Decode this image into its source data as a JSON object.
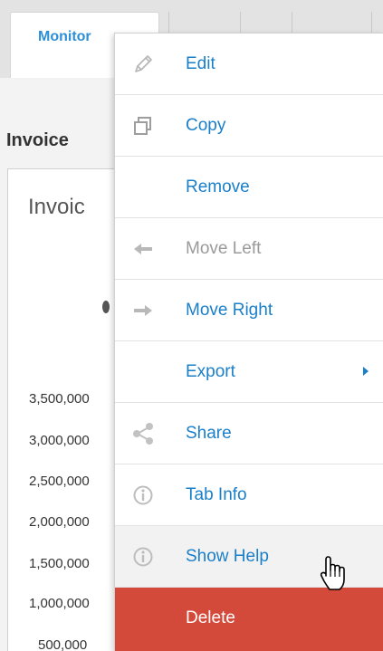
{
  "tab": {
    "active_label": "Monitor"
  },
  "section": {
    "title": "Invoice"
  },
  "widget": {
    "title": "Invoic",
    "y_ticks": [
      "3,500,000",
      "3,000,000",
      "2,500,000",
      "2,000,000",
      "1,500,000",
      "1,000,000",
      "500,000"
    ]
  },
  "menu": {
    "items": [
      {
        "label": "Edit",
        "icon": "pencil-icon",
        "state": "enabled"
      },
      {
        "label": "Copy",
        "icon": "copy-icon",
        "state": "enabled"
      },
      {
        "label": "Remove",
        "icon": "",
        "state": "enabled"
      },
      {
        "label": "Move Left",
        "icon": "arrow-left-icon",
        "state": "disabled"
      },
      {
        "label": "Move Right",
        "icon": "arrow-right-icon",
        "state": "enabled"
      },
      {
        "label": "Export",
        "icon": "",
        "state": "enabled",
        "submenu": true
      },
      {
        "label": "Share",
        "icon": "share-icon",
        "state": "enabled"
      },
      {
        "label": "Tab Info",
        "icon": "info-icon",
        "state": "enabled"
      },
      {
        "label": "Show Help",
        "icon": "info-icon",
        "state": "hover"
      },
      {
        "label": "Delete",
        "icon": "",
        "state": "danger"
      }
    ]
  },
  "colors": {
    "link": "#1a7fc9",
    "disabled": "#9a9a9a",
    "danger": "#d44a3a",
    "tab_accent": "#2d8fd6"
  }
}
